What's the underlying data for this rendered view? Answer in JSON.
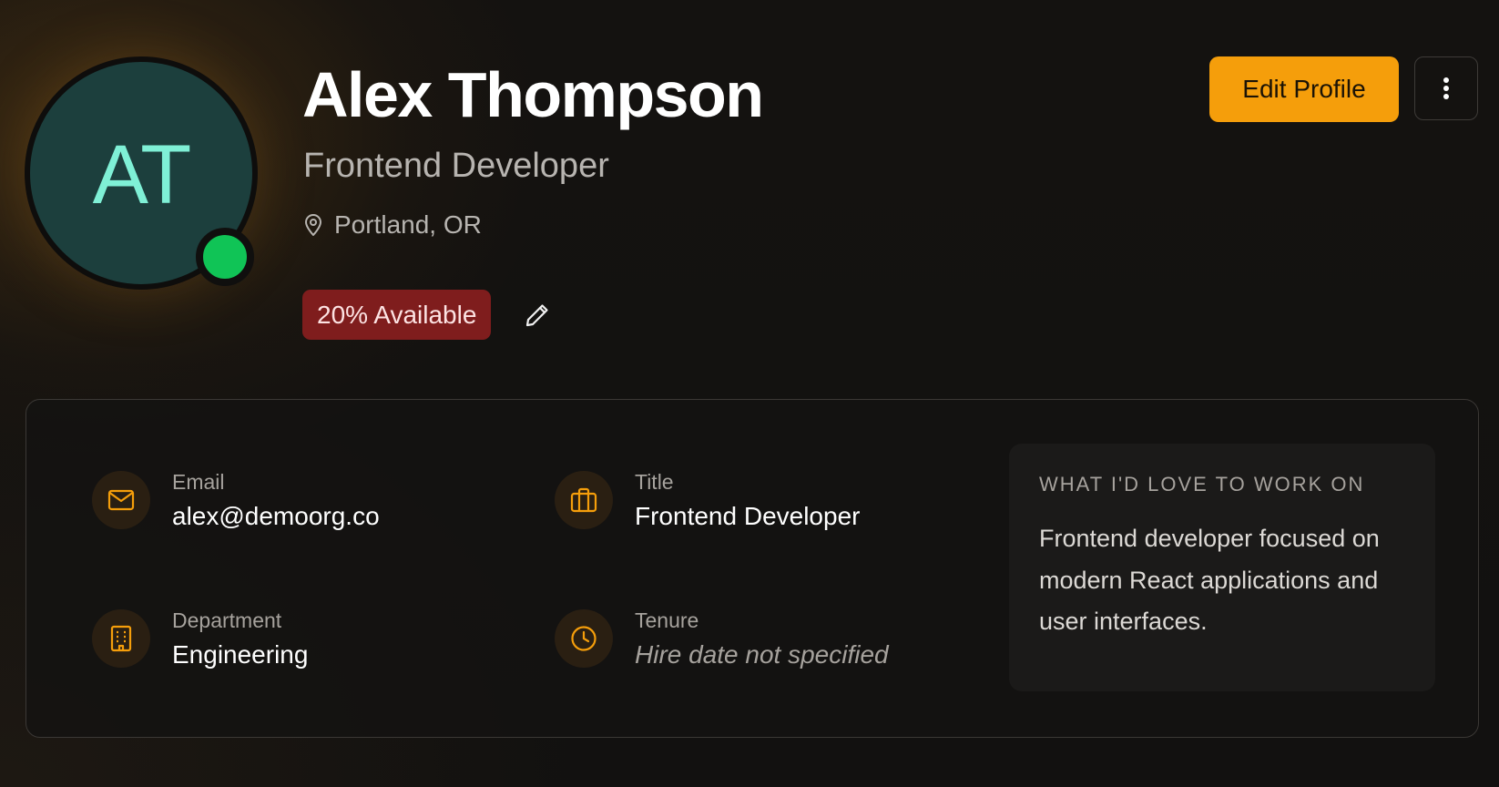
{
  "profile": {
    "initials": "AT",
    "name": "Alex Thompson",
    "role": "Frontend Developer",
    "location": "Portland, OR",
    "location_icon": "map-pin-icon",
    "online_status": "online",
    "availability": "20% Available"
  },
  "actions": {
    "edit_profile_label": "Edit Profile",
    "more_icon": "more-vertical-icon",
    "edit_availability_icon": "pencil-icon"
  },
  "details": {
    "email": {
      "label": "Email",
      "value": "alex@demoorg.co",
      "icon": "mail-icon"
    },
    "title": {
      "label": "Title",
      "value": "Frontend Developer",
      "icon": "briefcase-icon"
    },
    "department": {
      "label": "Department",
      "value": "Engineering",
      "icon": "building-icon"
    },
    "tenure": {
      "label": "Tenure",
      "value": "Hire date not specified",
      "icon": "clock-icon"
    }
  },
  "interests": {
    "heading": "WHAT I'D LOVE TO WORK ON",
    "body": "Frontend developer focused on modern React applications and user interfaces."
  },
  "colors": {
    "accent": "#f59e0b",
    "online": "#10c456",
    "availability_bg": "#7f1d1d",
    "avatar_bg": "#1c3f3d",
    "avatar_text": "#7ff0d6"
  }
}
